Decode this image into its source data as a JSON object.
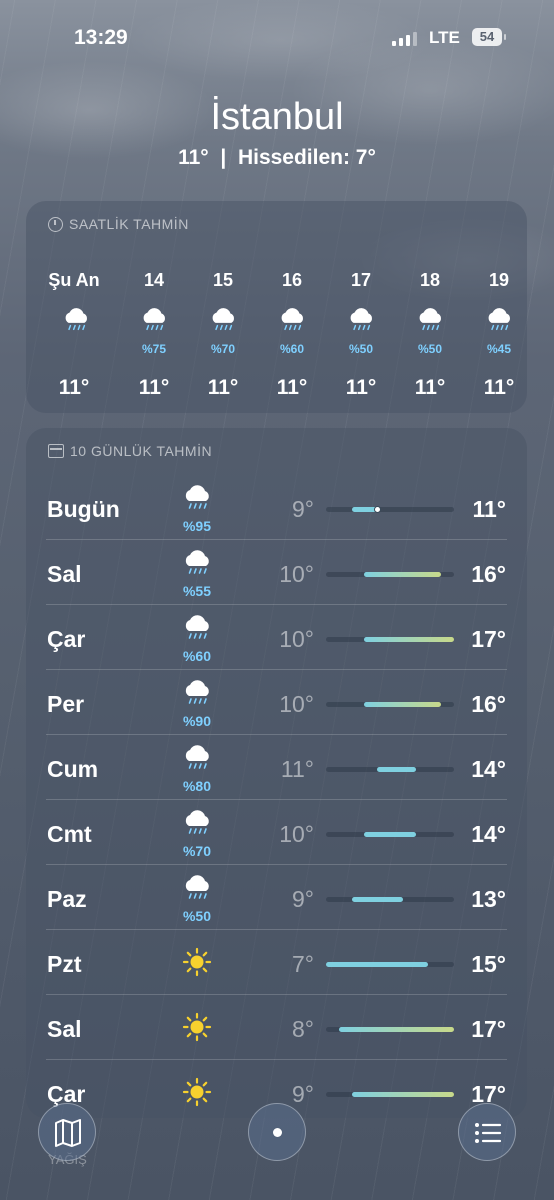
{
  "status_bar": {
    "time": "13:29",
    "network": "LTE",
    "battery": "54"
  },
  "location": {
    "city": "İstanbul",
    "current_temp": "11°",
    "separator": "|",
    "feels_like": "Hissedilen: 7°"
  },
  "hourly": {
    "title": "SAATLİK TAHMİN",
    "items": [
      {
        "time": "Şu An",
        "icon": "rain-cloud-icon",
        "precip": "",
        "temp": "11°"
      },
      {
        "time": "14",
        "icon": "rain-cloud-icon",
        "precip": "%75",
        "temp": "11°"
      },
      {
        "time": "15",
        "icon": "rain-cloud-icon",
        "precip": "%70",
        "temp": "11°"
      },
      {
        "time": "16",
        "icon": "rain-cloud-icon",
        "precip": "%60",
        "temp": "11°"
      },
      {
        "time": "17",
        "icon": "rain-cloud-icon",
        "precip": "%50",
        "temp": "11°"
      },
      {
        "time": "18",
        "icon": "rain-cloud-icon",
        "precip": "%50",
        "temp": "11°"
      },
      {
        "time": "19",
        "icon": "rain-cloud-icon",
        "precip": "%45",
        "temp": "11°"
      }
    ]
  },
  "daily": {
    "title": "10 GÜNLÜK TAHMİN",
    "range_min": 7,
    "range_max": 17,
    "current_temp_value": 11,
    "items": [
      {
        "day": "Bugün",
        "icon": "rain-cloud-icon",
        "precip": "%95",
        "low": "9°",
        "high": "11°",
        "low_value": 9,
        "high_value": 11
      },
      {
        "day": "Sal",
        "icon": "rain-cloud-icon",
        "precip": "%55",
        "low": "10°",
        "high": "16°",
        "low_value": 10,
        "high_value": 16
      },
      {
        "day": "Çar",
        "icon": "rain-cloud-icon",
        "precip": "%60",
        "low": "10°",
        "high": "17°",
        "low_value": 10,
        "high_value": 17
      },
      {
        "day": "Per",
        "icon": "rain-cloud-icon",
        "precip": "%90",
        "low": "10°",
        "high": "16°",
        "low_value": 10,
        "high_value": 16
      },
      {
        "day": "Cum",
        "icon": "rain-cloud-icon",
        "precip": "%80",
        "low": "11°",
        "high": "14°",
        "low_value": 11,
        "high_value": 14
      },
      {
        "day": "Cmt",
        "icon": "rain-cloud-icon",
        "precip": "%70",
        "low": "10°",
        "high": "14°",
        "low_value": 10,
        "high_value": 14
      },
      {
        "day": "Paz",
        "icon": "rain-cloud-icon",
        "precip": "%50",
        "low": "9°",
        "high": "13°",
        "low_value": 9,
        "high_value": 13
      },
      {
        "day": "Pzt",
        "icon": "sun-icon",
        "precip": "",
        "low": "7°",
        "high": "15°",
        "low_value": 7,
        "high_value": 15
      },
      {
        "day": "Sal",
        "icon": "sun-icon",
        "precip": "",
        "low": "8°",
        "high": "17°",
        "low_value": 8,
        "high_value": 17
      },
      {
        "day": "Çar",
        "icon": "sun-icon",
        "precip": "",
        "low": "9°",
        "high": "17°",
        "low_value": 9,
        "high_value": 17
      }
    ]
  },
  "next_section": {
    "label": "YAĞIŞ"
  },
  "toolbar": {
    "map": "map-icon",
    "location": "current-location-dot-icon",
    "list": "list-icon"
  },
  "colors": {
    "precip": "#7fd0ff",
    "bar_cool": "#7fd0e0",
    "bar_warm": "#c8d98a"
  }
}
